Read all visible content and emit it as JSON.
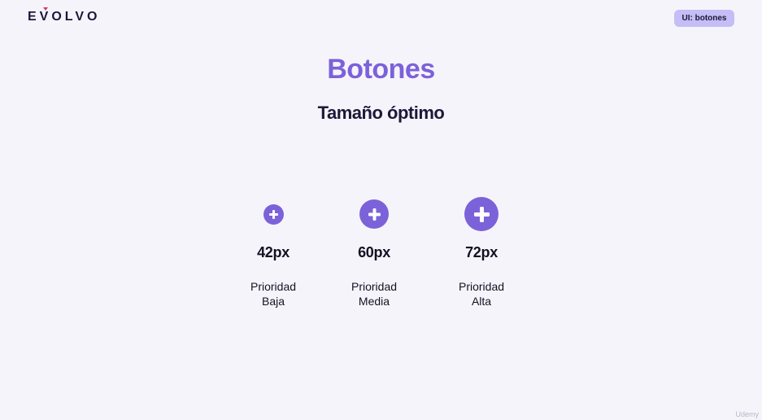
{
  "brand": {
    "logo_text": "EVOLVO"
  },
  "header": {
    "tag_label": "UI: botones"
  },
  "main": {
    "title": "Botones",
    "subtitle": "Tamaño óptimo",
    "sizes": [
      {
        "size_label": "42px",
        "priority_line1": "Prioridad",
        "priority_line2": "Baja"
      },
      {
        "size_label": "60px",
        "priority_line1": "Prioridad",
        "priority_line2": "Media"
      },
      {
        "size_label": "72px",
        "priority_line1": "Prioridad",
        "priority_line2": "Alta"
      }
    ]
  },
  "footer": {
    "watermark": "Udemy"
  },
  "colors": {
    "background": "#f6f4fb",
    "accent": "#7b62d9",
    "tag_bg": "#c4bdf6",
    "text_dark": "#1d1838",
    "logo_heart": "#e0336b"
  },
  "icons": {
    "plus": "plus-icon"
  }
}
